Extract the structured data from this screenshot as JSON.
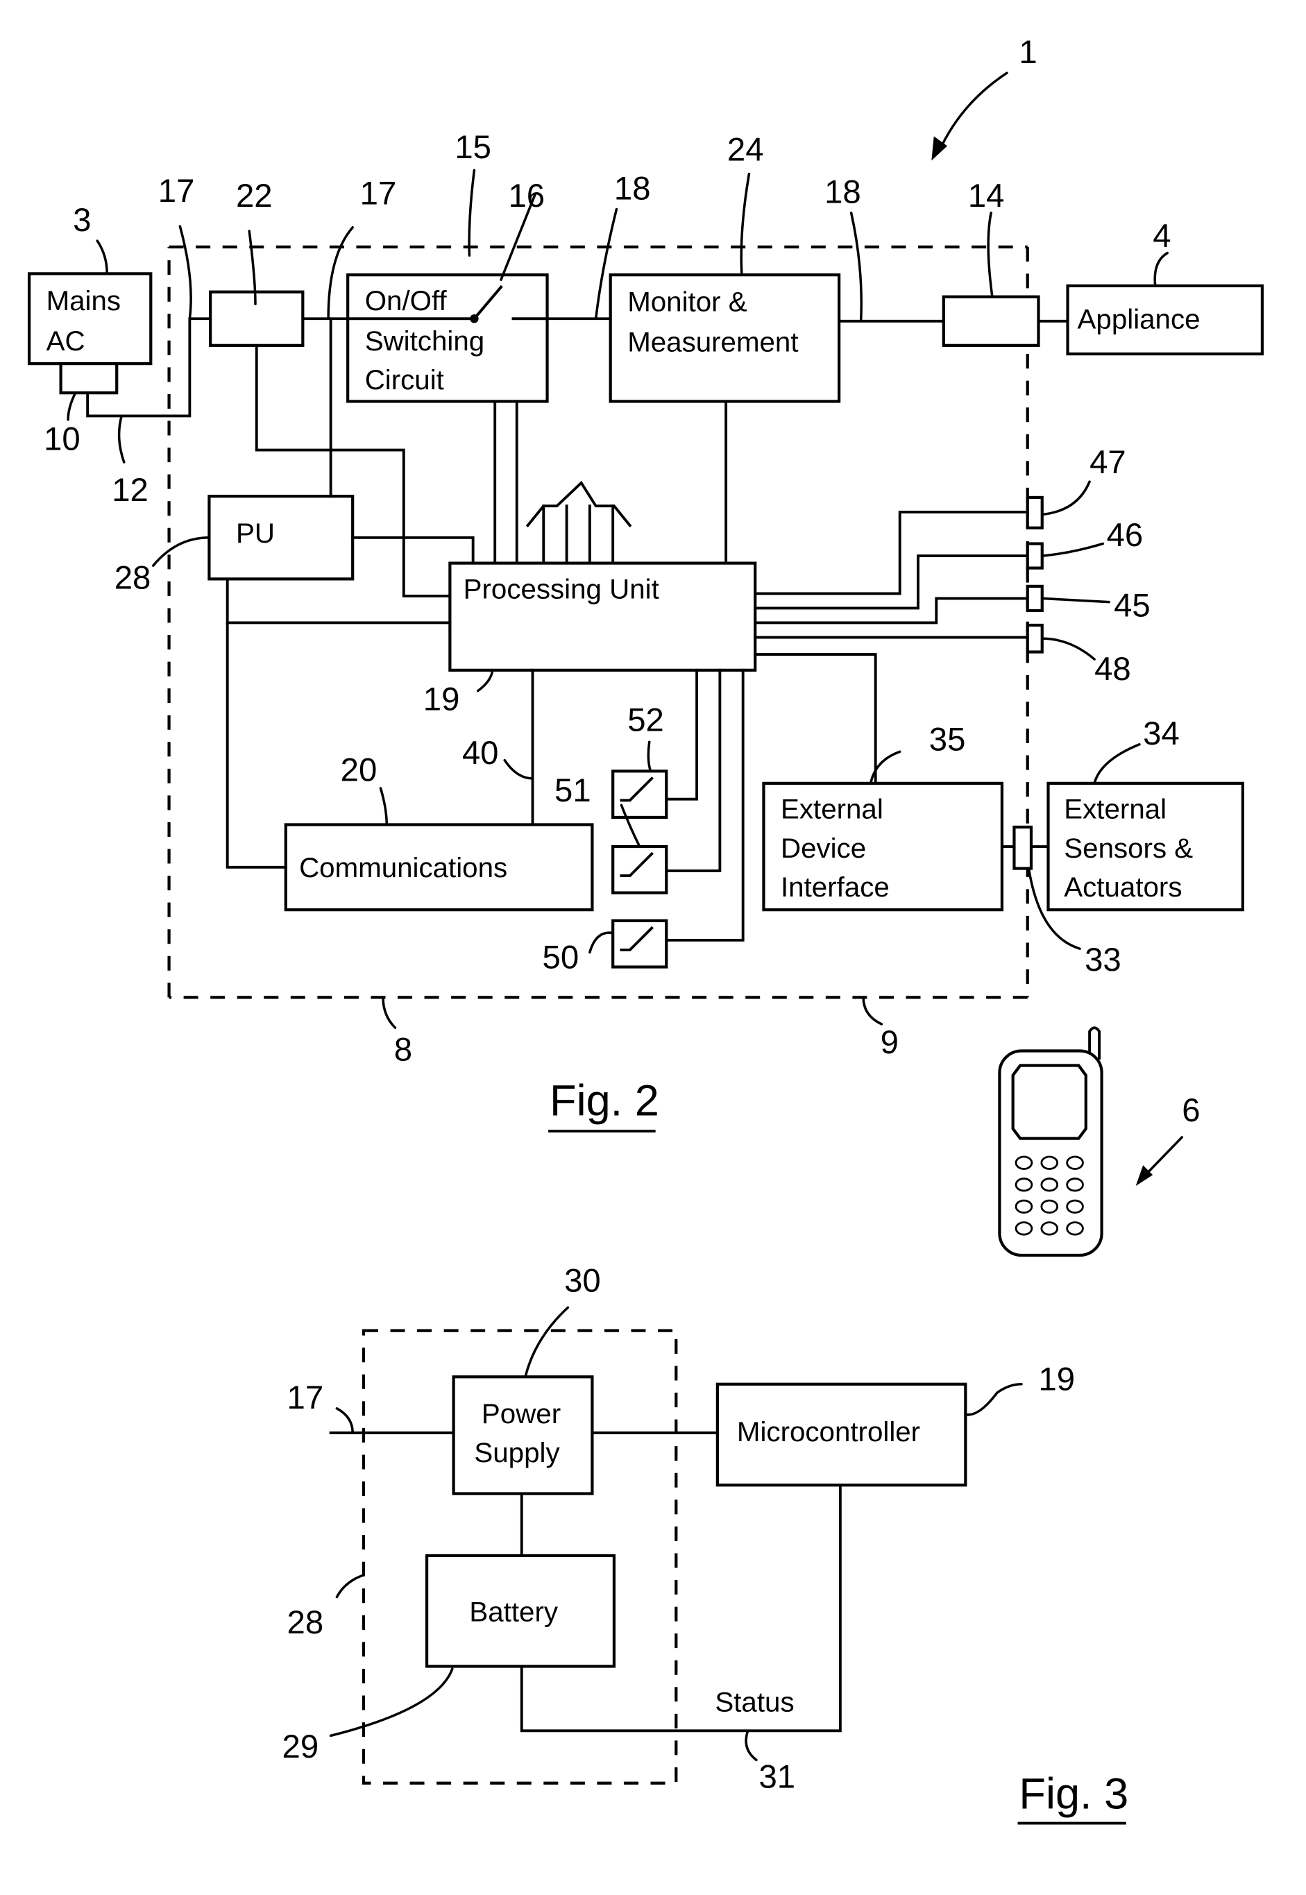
{
  "figure2": {
    "caption": "Fig. 2",
    "blocks": {
      "mains": [
        "Mains",
        "AC"
      ],
      "switching": [
        "On/Off",
        "Switching",
        "Circuit"
      ],
      "monitor": [
        "Monitor &",
        "Measurement"
      ],
      "appliance": "Appliance",
      "pu": "PU",
      "processing": "Processing Unit",
      "communications": "Communications",
      "ext_interface": [
        "External",
        "Device",
        "Interface"
      ],
      "ext_sensors": [
        "External",
        "Sensors &",
        "Actuators"
      ]
    },
    "refs": {
      "system": "1",
      "mains": "3",
      "appliance": "4",
      "phone": "6",
      "housing_8": "8",
      "housing_9": "9",
      "plug": "10",
      "cable": "12",
      "socket": "14",
      "switching": "15",
      "switch": "16",
      "line_17a": "17",
      "line_17b": "17",
      "line_18a": "18",
      "line_18b": "18",
      "processing": "19",
      "communications": "20",
      "fuse": "22",
      "monitor": "24",
      "pu": "28",
      "connector_33": "33",
      "ext_sensors": "34",
      "ext_interface": "35",
      "bus_40": "40",
      "port_45": "45",
      "port_46": "46",
      "port_47": "47",
      "port_48": "48",
      "switch_50": "50",
      "switch_51": "51",
      "switch_52": "52"
    }
  },
  "figure3": {
    "caption": "Fig. 3",
    "blocks": {
      "power_supply": [
        "Power",
        "Supply"
      ],
      "battery": "Battery",
      "microcontroller": "Microcontroller",
      "status": "Status"
    },
    "refs": {
      "line_17": "17",
      "pu": "28",
      "battery": "29",
      "power_supply": "30",
      "status_line": "31",
      "microcontroller": "19"
    }
  }
}
